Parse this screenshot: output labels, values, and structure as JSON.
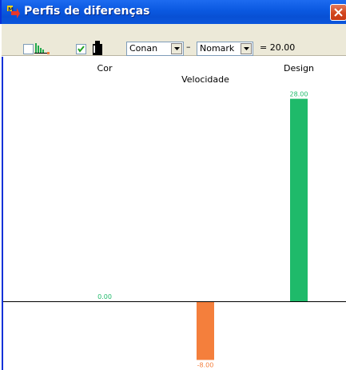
{
  "window": {
    "title": "Perfis de diferenças"
  },
  "toolbar": {
    "profile_checkbox_checked": false,
    "weight_checkbox_checked": true,
    "product_a": "Conan",
    "separator": "–",
    "product_b": "Nomark",
    "equals_label": "= 20.00"
  },
  "colors": {
    "positive": "#1fba6a",
    "negative": "#f47f3c",
    "zero": "#1fba6a"
  },
  "chart_data": {
    "type": "bar",
    "categories": [
      "Cor",
      "Velocidade",
      "Design"
    ],
    "values": [
      0.0,
      -8.0,
      28.0
    ],
    "value_labels": [
      "0.00",
      "-8.00",
      "28.00"
    ],
    "ylim": [
      -8.5,
      29.5
    ]
  }
}
